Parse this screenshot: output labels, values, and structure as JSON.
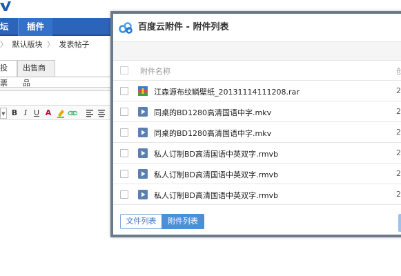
{
  "nav": {
    "forum_label": "坛",
    "plugin_label": "插件"
  },
  "breadcrumb": {
    "items": [
      "默认版块",
      "发表帖子"
    ]
  },
  "post_tabs": {
    "vote_label": "投票",
    "goods_label": "出售商品"
  },
  "editor_toolbar": {
    "bold": "B",
    "italic": "I",
    "underline": "U",
    "color": "A"
  },
  "dialog": {
    "title": "百度云附件 - 附件列表",
    "header_name": "附件名称",
    "header_date": "创",
    "files": [
      {
        "name": "江森源布纹鳞壁纸_20131114111208.rar",
        "date": "2",
        "type": "archive-icon"
      },
      {
        "name": "同桌的BD1280高清国语中字.mkv",
        "date": "2",
        "type": "video-icon"
      },
      {
        "name": "同桌的BD1280高清国语中字.mkv",
        "date": "2",
        "type": "video-icon"
      },
      {
        "name": "私人订制BD高清国语中英双字.rmvb",
        "date": "2",
        "type": "video-icon"
      },
      {
        "name": "私人订制BD高清国语中英双字.rmvb",
        "date": "2",
        "type": "video-icon"
      },
      {
        "name": "私人订制BD高清国语中英双字.rmvb",
        "date": "2",
        "type": "video-icon"
      }
    ],
    "footer": {
      "file_list_label": "文件列表",
      "attach_list_label": "附件列表"
    }
  },
  "colors": {
    "nav_blue": "#2b64b8",
    "accent_blue": "#4a90d9",
    "dialog_border": "#6b7a8b"
  }
}
